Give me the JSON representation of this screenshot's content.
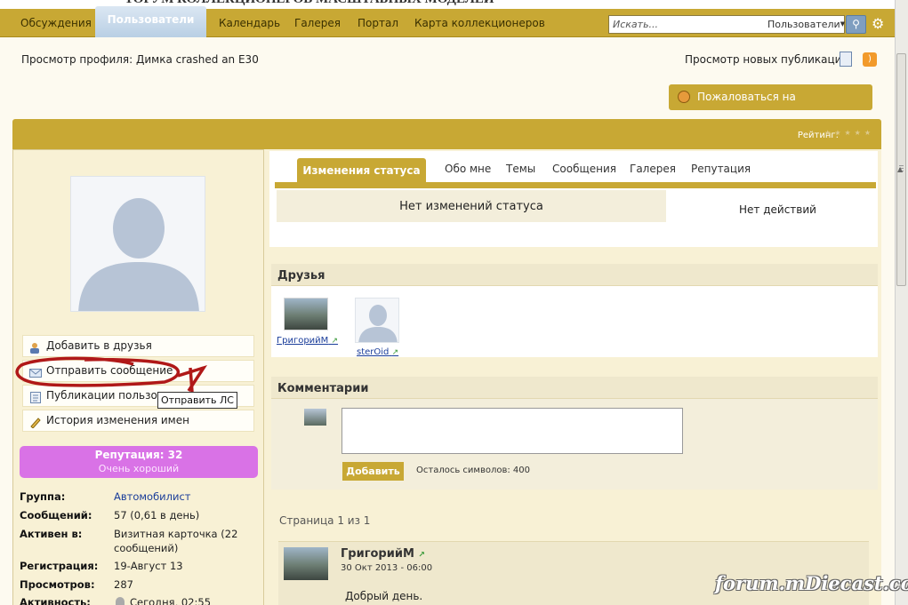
{
  "top_cut_text": "ТОРУМ КОЛЛЕКЦИОНЕРОВ МАСШТАБНЫХ МОДЕЛЕЙ",
  "nav": {
    "tabs": [
      "Обсуждения",
      "Пользователи",
      "Календарь",
      "Галерея",
      "Портал",
      "Карта коллекционеров"
    ],
    "active": "Пользователи",
    "search_placeholder": "Искать...",
    "search_scope": "Пользователи",
    "search_icon": "search-icon",
    "settings_icon": "gear-icon"
  },
  "header": {
    "breadcrumb": "Просмотр профиля: Димка crashed an E30",
    "new_pubs": "Просмотр новых публикаций",
    "report_button": "Пожаловаться на пользователя",
    "rating_label": "Рейтинг:",
    "rating_stars": "★★★★★",
    "rating_value": 0
  },
  "sidebar": {
    "menu": [
      {
        "label": "Добавить в друзья",
        "icon": "add-friend-icon"
      },
      {
        "label": "Отправить сообщение",
        "icon": "message-icon"
      },
      {
        "label": "Публикации пользова",
        "icon": "document-icon"
      },
      {
        "label": "История изменения имен",
        "icon": "pencil-icon"
      }
    ],
    "tooltip": "Отправить ЛС",
    "annotation_mark": "1",
    "reputation_title": "Репутация: 32",
    "reputation_sub": "Очень хороший",
    "info": {
      "group_label": "Группа:",
      "group_value": "Автомобилист",
      "posts_label": "Сообщений:",
      "posts_value": "57 (0,61 в день)",
      "active_label": "Активен в:",
      "active_value": "Визитная карточка (22 сообщений)",
      "reg_label": "Регистрация:",
      "reg_value": "19-Август 13",
      "views_label": "Просмотров:",
      "views_value": "287",
      "activity_label": "Активность:",
      "activity_value": "Сегодня, 02:55"
    }
  },
  "profile_tabs": {
    "active": "Изменения статуса",
    "others": [
      "Обо мне",
      "Темы",
      "Сообщения",
      "Галерея",
      "Репутация"
    ],
    "no_status": "Нет изменений статуса",
    "no_actions": "Нет действий"
  },
  "friends": {
    "title": "Друзья",
    "list": [
      {
        "name": "ГригорийМ"
      },
      {
        "name": "sterOid"
      }
    ]
  },
  "comments": {
    "title": "Комментарии",
    "add_button": "Добавить",
    "chars_left": "Осталось символов: 400"
  },
  "pagination": {
    "text": "Страница 1 из 1"
  },
  "post": {
    "author": "ГригорийМ",
    "date": "30 Окт 2013 - 06:00",
    "text": "Добрый день."
  },
  "watermark": "forum.mDiecast.com",
  "colors": {
    "accent": "#c8a834",
    "reputation": "#d972e6",
    "link": "#1a3d9a"
  }
}
